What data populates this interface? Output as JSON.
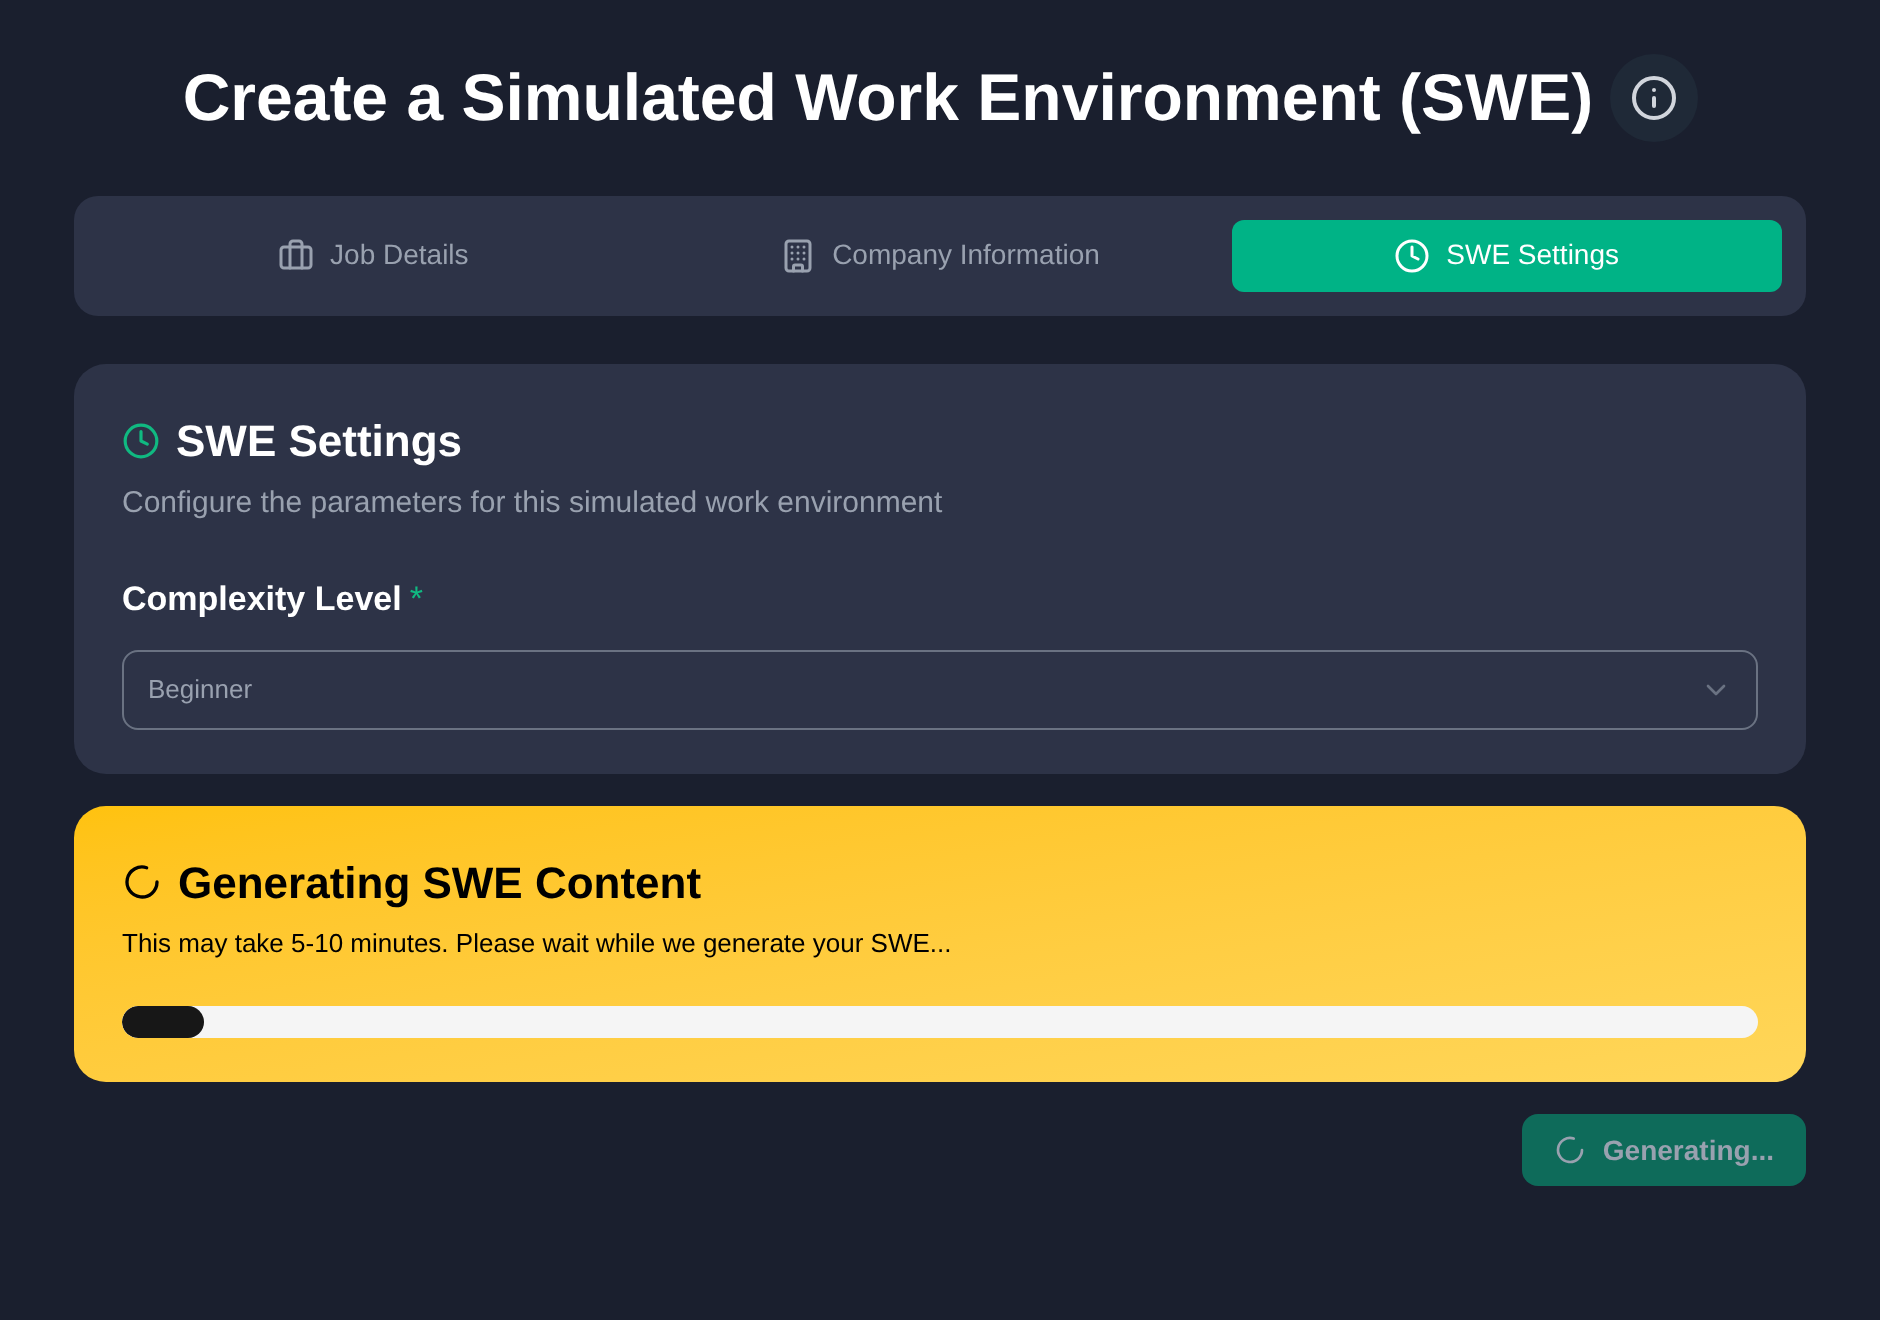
{
  "title": "Create a Simulated Work Environment (SWE)",
  "tabs": [
    {
      "label": "Job Details",
      "selected": false
    },
    {
      "label": "Company Information",
      "selected": false
    },
    {
      "label": "SWE Settings",
      "selected": true
    }
  ],
  "settings": {
    "title": "SWE Settings",
    "description": "Configure the parameters for this simulated work environment",
    "field": {
      "label": "Complexity Level",
      "required_mark": "*",
      "value": "Beginner"
    }
  },
  "progress": {
    "title": "Generating SWE Content",
    "message": "This may take 5-10 minutes. Please wait while we generate your SWE...",
    "level": 0.05
  },
  "button": {
    "label": "Generating...",
    "disabled": true
  }
}
